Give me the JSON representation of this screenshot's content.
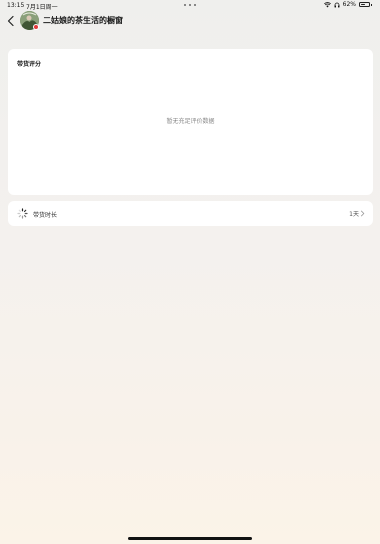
{
  "status_bar": {
    "time": "13:15",
    "date": "7月1日周一",
    "battery": "62%",
    "battery_level": 0.62
  },
  "nav": {
    "title": "二姑娘的茶生活的橱窗"
  },
  "rating_card": {
    "title": "带货评分",
    "empty_text": "暂无充足评价数据"
  },
  "duration_row": {
    "label": "带货时长",
    "value": "1天"
  }
}
